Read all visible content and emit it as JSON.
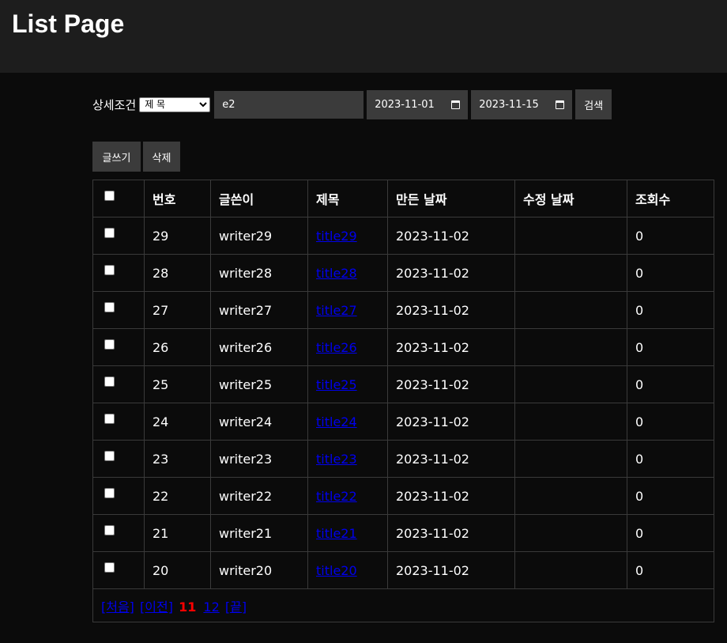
{
  "header": {
    "title": "List Page"
  },
  "search": {
    "label": "상세조건",
    "condition": "제 목",
    "keyword": "e2",
    "start_date": "2023-11-01",
    "end_date": "2023-11-15",
    "button": "검색"
  },
  "actions": {
    "write": "글쓰기",
    "delete": "삭제"
  },
  "table": {
    "headers": [
      "번호",
      "글쓴이",
      "제목",
      "만든 날짜",
      "수정 날짜",
      "조회수"
    ],
    "rows": [
      {
        "no": "29",
        "writer": "writer29",
        "title": "title29",
        "created": "2023-11-02",
        "modified": "",
        "views": "0"
      },
      {
        "no": "28",
        "writer": "writer28",
        "title": "title28",
        "created": "2023-11-02",
        "modified": "",
        "views": "0"
      },
      {
        "no": "27",
        "writer": "writer27",
        "title": "title27",
        "created": "2023-11-02",
        "modified": "",
        "views": "0"
      },
      {
        "no": "26",
        "writer": "writer26",
        "title": "title26",
        "created": "2023-11-02",
        "modified": "",
        "views": "0"
      },
      {
        "no": "25",
        "writer": "writer25",
        "title": "title25",
        "created": "2023-11-02",
        "modified": "",
        "views": "0"
      },
      {
        "no": "24",
        "writer": "writer24",
        "title": "title24",
        "created": "2023-11-02",
        "modified": "",
        "views": "0"
      },
      {
        "no": "23",
        "writer": "writer23",
        "title": "title23",
        "created": "2023-11-02",
        "modified": "",
        "views": "0"
      },
      {
        "no": "22",
        "writer": "writer22",
        "title": "title22",
        "created": "2023-11-02",
        "modified": "",
        "views": "0"
      },
      {
        "no": "21",
        "writer": "writer21",
        "title": "title21",
        "created": "2023-11-02",
        "modified": "",
        "views": "0"
      },
      {
        "no": "20",
        "writer": "writer20",
        "title": "title20",
        "created": "2023-11-02",
        "modified": "",
        "views": "0"
      }
    ]
  },
  "pager": {
    "first": "[처음]",
    "prev": "[이전]",
    "current": "11",
    "pages": [
      "12"
    ],
    "last": "[끝]"
  },
  "colors": {
    "link": "#0000ee",
    "current_page": "#ff0000",
    "header_bg": "#1d1d1d",
    "page_bg": "#0b0b0b"
  }
}
